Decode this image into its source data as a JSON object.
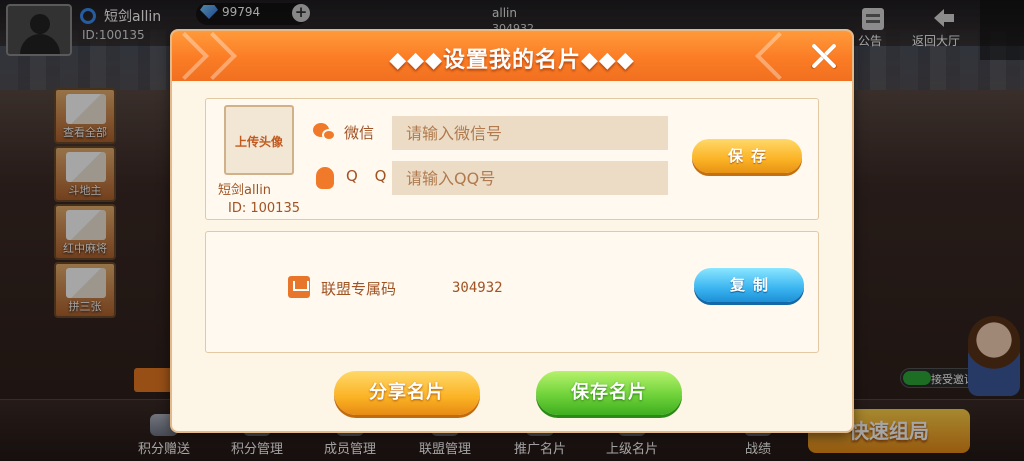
{
  "topbar": {
    "username": "短剑allin",
    "user_id": "ID:100135",
    "diamonds": "99794",
    "plus": "+",
    "center_name": "allin",
    "center_num": "304932",
    "right_items": [
      {
        "label": "公告"
      },
      {
        "label": "返回大厅"
      }
    ]
  },
  "left_games": [
    {
      "label": "查看全部"
    },
    {
      "label": "斗地主"
    },
    {
      "label": "红中麻将"
    },
    {
      "label": "拼三张"
    }
  ],
  "bottom_nav": [
    {
      "label": "积分赠送"
    },
    {
      "label": "积分管理"
    },
    {
      "label": "成员管理"
    },
    {
      "label": "联盟管理"
    },
    {
      "label": "推广名片"
    },
    {
      "label": "上级名片"
    },
    {
      "label": "战绩"
    }
  ],
  "quick_start_label": "快速组局",
  "accept_invite_label": "接受邀请",
  "modal": {
    "title": "◆◆◆设置我的名片◆◆◆",
    "upload_avatar_label": "上传头像",
    "card_name": "短剑allin",
    "card_id": "ID: 100135",
    "wechat_label": "微信",
    "wechat_placeholder": "请输入微信号",
    "qq_label": "Q Q",
    "qq_placeholder": "请输入QQ号",
    "save_label": "保存",
    "alliance_code_label": "联盟专属码",
    "alliance_code_value": "304932",
    "copy_label": "复制",
    "share_card_label": "分享名片",
    "save_card_label": "保存名片"
  },
  "colors": {
    "header_orange": "#fb7c25",
    "label_brown": "#a05324",
    "save_yellow": "#fbb224",
    "copy_blue": "#3ab4f0",
    "save_card_green": "#6fd23a"
  }
}
